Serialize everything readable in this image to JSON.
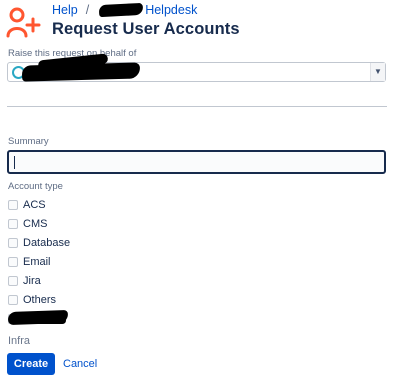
{
  "header": {
    "breadcrumb": {
      "help": "Help",
      "separator": "/",
      "project": "Helpdesk"
    },
    "title": "Request User Accounts",
    "icon": "add-user-icon"
  },
  "form": {
    "behalf": {
      "label": "Raise this request on behalf of",
      "value": ""
    },
    "summary": {
      "label": "Summary",
      "value": ""
    },
    "account_type": {
      "label": "Account type",
      "options": [
        "ACS",
        "CMS",
        "Database",
        "Email",
        "Jira",
        "Others"
      ],
      "trailing_text": "Infra"
    },
    "create_label": "Create",
    "cancel_label": "Cancel"
  },
  "colors": {
    "primary": "#0052cc",
    "icon": "#ff5630",
    "text": "#172b4d"
  }
}
